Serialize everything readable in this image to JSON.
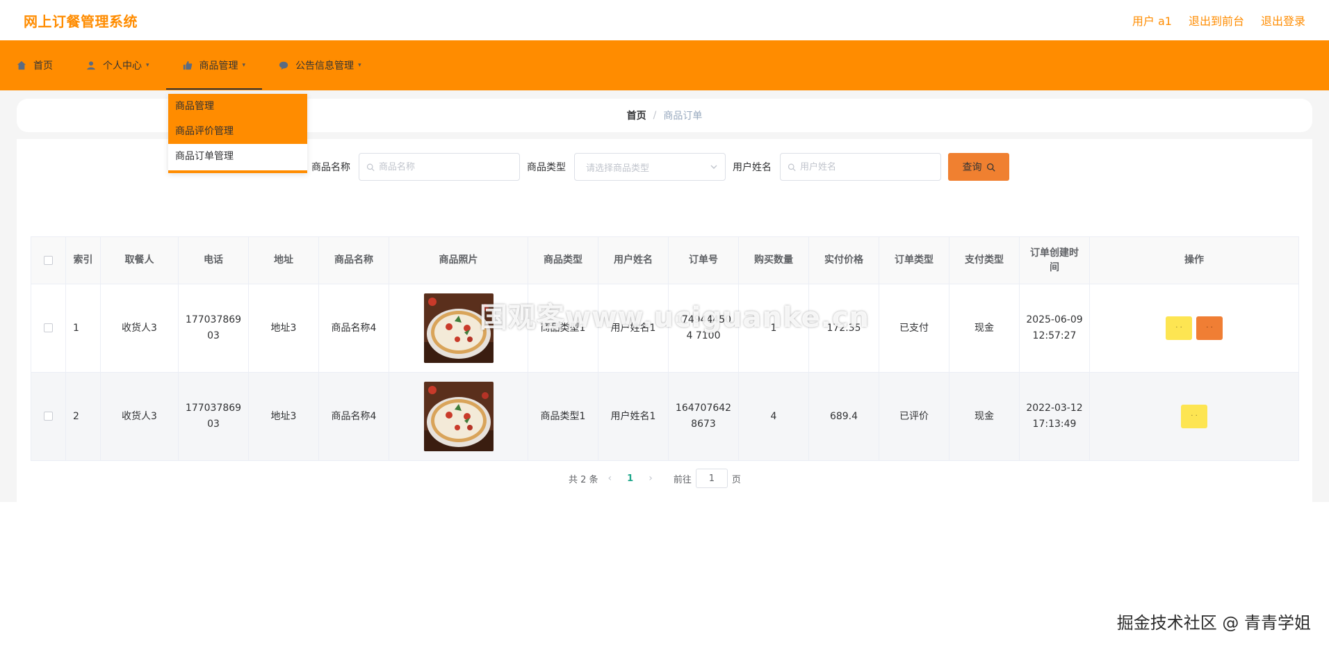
{
  "header": {
    "title": "网上订餐管理系统",
    "user": "用户 a1",
    "to_front": "退出到前台",
    "logout": "退出登录"
  },
  "nav": {
    "items": [
      {
        "label": "首页",
        "icon": "home-icon"
      },
      {
        "label": "个人中心",
        "icon": "user-icon"
      },
      {
        "label": "商品管理",
        "icon": "thumb-up-icon"
      },
      {
        "label": "公告信息管理",
        "icon": "chat-icon"
      }
    ]
  },
  "dropdown": {
    "items": [
      "商品管理",
      "商品评价管理",
      "商品订单管理"
    ]
  },
  "breadcrumb": {
    "home": "首页",
    "sep": "/",
    "current": "商品订单"
  },
  "search": {
    "name_label": "商品名称",
    "name_placeholder": "商品名称",
    "type_label": "商品类型",
    "type_placeholder": "请选择商品类型",
    "user_label": "用户姓名",
    "user_placeholder": "用户姓名",
    "button": "查询"
  },
  "table": {
    "headers": [
      "索引",
      "取餐人",
      "电话",
      "地址",
      "商品名称",
      "商品照片",
      "商品类型",
      "用户姓名",
      "订单号",
      "购买数量",
      "实付价格",
      "订单类型",
      "支付类型",
      "订单创建时间",
      "操作"
    ],
    "rows": [
      {
        "index": "1",
        "receiver": "收货人3",
        "phone": "17703786903",
        "address": "地址3",
        "product": "商品名称4",
        "type": "商品类型1",
        "user": "用户姓名1",
        "order_no": "1749444504 7100",
        "qty": "1",
        "price": "172.35",
        "order_type": "已支付",
        "pay_type": "现金",
        "created": "2025-06-09 12:57:27"
      },
      {
        "index": "2",
        "receiver": "收货人3",
        "phone": "17703786903",
        "address": "地址3",
        "product": "商品名称4",
        "type": "商品类型1",
        "user": "用户姓名1",
        "order_no": "1647076428673",
        "qty": "4",
        "price": "689.4",
        "order_type": "已评价",
        "pay_type": "现金",
        "created": "2022-03-12 17:13:49"
      }
    ],
    "action_short": "· ·"
  },
  "pagination": {
    "total": "共 2 条",
    "current": "1",
    "goto": "前往",
    "page_value": "1",
    "page_suffix": "页"
  },
  "watermark": {
    "center": "国观客www.uciguanke.cn",
    "corner": "掘金技术社区 @ 青青学姐"
  },
  "colors": {
    "brand": "#ff8c00",
    "search_button": "#f08030",
    "edit_button": "#fde552",
    "delete_button": "#f07e34",
    "page_active": "#1fa78b"
  }
}
